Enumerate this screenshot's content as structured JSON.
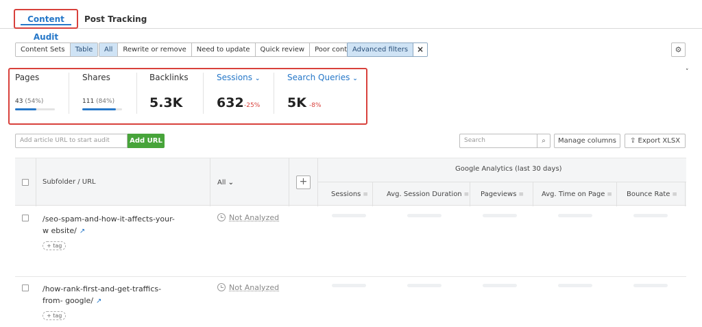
{
  "tabs": {
    "content_audit": "Content Audit",
    "post_tracking": "Post Tracking"
  },
  "view_toggle": {
    "content_sets": "Content Sets",
    "table": "Table"
  },
  "filters": {
    "all": "All",
    "rewrite": "Rewrite or remove",
    "need_update": "Need to update",
    "quick_review": "Quick review",
    "poor": "Poor content",
    "advanced": "Advanced filters",
    "clear": "×"
  },
  "icons": {
    "settings": "gear-icon",
    "search": "search-icon",
    "export": "export-icon",
    "external": "external-link-icon",
    "clock": "clock-icon"
  },
  "metrics": {
    "pages": {
      "title": "Pages",
      "count": "43",
      "pct": "(54%)",
      "progress": 0.54
    },
    "shares": {
      "title": "Shares",
      "count": "111",
      "pct": "(84%)",
      "progress": 0.84
    },
    "backlinks": {
      "title": "Backlinks",
      "value": "5.3K"
    },
    "sessions": {
      "title": "Sessions",
      "value": "632",
      "delta": "-25%"
    },
    "queries": {
      "title": "Search Queries",
      "value": "5K",
      "delta": "-8%"
    }
  },
  "add_url": {
    "placeholder": "Add article URL to start audit",
    "button": "Add URL"
  },
  "toolbar": {
    "search_placeholder": "Search",
    "manage_columns": "Manage columns",
    "export": "Export XLSX"
  },
  "table": {
    "col_url": "Subfolder / URL",
    "col_filter": "All",
    "group_label": "Google Analytics (last 30 days)",
    "columns": [
      "Sessions",
      "Avg. Session Duration",
      "Pageviews",
      "Avg. Time on Page",
      "Bounce Rate"
    ],
    "rows": [
      {
        "url": "/seo-spam-and-how-it-affects-your-w ebsite/",
        "tag": "+ tag",
        "status": "Not Analyzed"
      },
      {
        "url": "/how-rank-first-and-get-traffics-from- google/",
        "tag": "+ tag",
        "status": "Not Analyzed"
      }
    ]
  },
  "colors": {
    "accent": "#2577c8",
    "highlight_border": "#d8403b",
    "add_button": "#47a43a",
    "negative": "#d8403b"
  }
}
